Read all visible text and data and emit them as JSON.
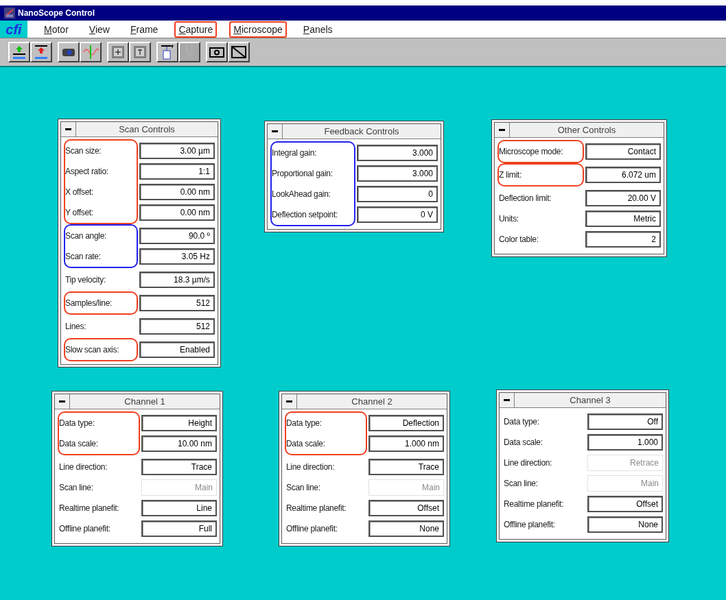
{
  "window": {
    "title": "NanoScope Control"
  },
  "menu": {
    "logo": "cfi",
    "items": [
      {
        "label": "Motor"
      },
      {
        "label": "View"
      },
      {
        "label": "Frame"
      },
      {
        "label": "Capture",
        "color": "#f04020"
      },
      {
        "label": "Microscope",
        "color": "#f04020"
      },
      {
        "label": "Panels"
      }
    ]
  },
  "toolbar": [
    {
      "disabled": false
    },
    {
      "disabled": false
    },
    {
      "disabled": false
    },
    {
      "disabled": false
    },
    {
      "disabled": false
    },
    {
      "disabled": false
    },
    {
      "disabled": false
    },
    {
      "disabled": true
    },
    {
      "disabled": false
    },
    {
      "disabled": false
    }
  ],
  "panels": [
    {
      "title": "Scan Controls",
      "groups": [
        {
          "color": "#f04020",
          "rows": [
            {
              "label": "Scan size:",
              "value": "3.00 µm",
              "disabled": false
            },
            {
              "label": "Aspect ratio:",
              "value": "1:1",
              "disabled": false
            },
            {
              "label": "X offset:",
              "value": "0.00 nm",
              "disabled": false
            },
            {
              "label": "Y offset:",
              "value": "0.00 nm",
              "disabled": false
            }
          ]
        },
        {
          "color": "#2020f0",
          "rows": [
            {
              "label": "Scan angle:",
              "value": "90.0 º",
              "disabled": false
            },
            {
              "label": "Scan rate:",
              "value": "3.05 Hz",
              "disabled": false
            }
          ]
        },
        {
          "rows": [
            {
              "label": "Tip velocity:",
              "value": "18.3 µm/s",
              "disabled": false
            }
          ]
        },
        {
          "color": "#f04020",
          "rows": [
            {
              "label": "Samples/line:",
              "value": "512",
              "disabled": false
            }
          ]
        },
        {
          "rows": [
            {
              "label": "Lines:",
              "value": "512",
              "disabled": false
            }
          ]
        },
        {
          "color": "#f04020",
          "rows": [
            {
              "label": "Slow scan axis:",
              "value": "Enabled",
              "disabled": false
            }
          ]
        }
      ]
    },
    {
      "title": "Feedback Controls",
      "groups": [
        {
          "color": "#2020f0",
          "rows": [
            {
              "label": "Integral gain:",
              "value": "3.000",
              "disabled": false
            },
            {
              "label": "Proportional gain:",
              "value": "3.000",
              "disabled": false
            },
            {
              "label": "LookAhead gain:",
              "value": "0",
              "disabled": false
            },
            {
              "label": "Deflection setpoint:",
              "value": "0 V",
              "disabled": false
            }
          ]
        }
      ]
    },
    {
      "title": "Other Controls",
      "groups": [
        {
          "color": "#f04020",
          "rows": [
            {
              "label": "Microscope mode:",
              "value": "Contact",
              "disabled": false
            }
          ]
        },
        {
          "color": "#f04020",
          "rows": [
            {
              "label": "Z limit:",
              "value": "6.072 um",
              "disabled": false
            }
          ]
        },
        {
          "rows": [
            {
              "label": "Deflection limit:",
              "value": "20.00 V",
              "disabled": false
            },
            {
              "label": "Units:",
              "value": "Metric",
              "disabled": false
            },
            {
              "label": "Color table:",
              "value": "2",
              "disabled": false
            }
          ]
        }
      ]
    },
    {
      "title": "Channel 1",
      "groups": [
        {
          "color": "#f04020",
          "rows": [
            {
              "label": "Data type:",
              "value": "Height",
              "disabled": false
            },
            {
              "label": "Data scale:",
              "value": "10.00 nm",
              "disabled": false
            }
          ]
        },
        {
          "rows": [
            {
              "label": "Line direction:",
              "value": "Trace",
              "disabled": false
            },
            {
              "label": "Scan line:",
              "value": "Main",
              "disabled": true
            },
            {
              "label": "Realtime planefit:",
              "value": "Line",
              "disabled": false
            },
            {
              "label": "Offline planefit:",
              "value": "Full",
              "disabled": false
            }
          ]
        }
      ]
    },
    {
      "title": "Channel 2",
      "groups": [
        {
          "color": "#f04020",
          "rows": [
            {
              "label": "Data type:",
              "value": "Deflection",
              "disabled": false
            },
            {
              "label": "Data scale:",
              "value": "1.000 nm",
              "disabled": false
            }
          ]
        },
        {
          "rows": [
            {
              "label": "Line direction:",
              "value": "Trace",
              "disabled": false
            },
            {
              "label": "Scan line:",
              "value": "Main",
              "disabled": true
            },
            {
              "label": "Realtime planefit:",
              "value": "Offset",
              "disabled": false
            },
            {
              "label": "Offline planefit:",
              "value": "None",
              "disabled": false
            }
          ]
        }
      ]
    },
    {
      "title": "Channel 3",
      "groups": [
        {
          "rows": [
            {
              "label": "Data type:",
              "value": "Off",
              "disabled": false
            },
            {
              "label": "Data scale:",
              "value": "1.000",
              "disabled": false
            },
            {
              "label": "Line direction:",
              "value": "Retrace",
              "disabled": true
            },
            {
              "label": "Scan line:",
              "value": "Main",
              "disabled": true
            },
            {
              "label": "Realtime planefit:",
              "value": "Offset",
              "disabled": false
            },
            {
              "label": "Offline planefit:",
              "value": "None",
              "disabled": false
            }
          ]
        }
      ]
    }
  ]
}
